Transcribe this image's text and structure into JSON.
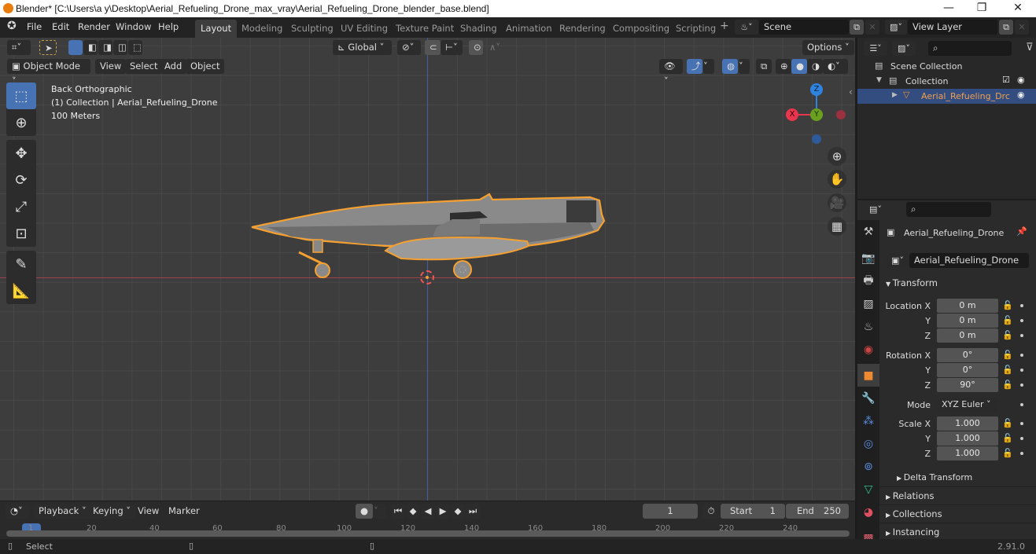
{
  "window": {
    "title": "Blender* [C:\\Users\\a y\\Desktop\\Aerial_Refueling_Drone_max_vray\\Aerial_Refueling_Drone_blender_base.blend]",
    "controls": {
      "minimize": "—",
      "maximize": "❐",
      "close": "✕"
    }
  },
  "menu": [
    "File",
    "Edit",
    "Render",
    "Window",
    "Help"
  ],
  "workspaces": [
    {
      "label": "Layout",
      "active": true
    },
    {
      "label": "Modeling"
    },
    {
      "label": "Sculpting"
    },
    {
      "label": "UV Editing"
    },
    {
      "label": "Texture Paint"
    },
    {
      "label": "Shading"
    },
    {
      "label": "Animation"
    },
    {
      "label": "Rendering"
    },
    {
      "label": "Compositing"
    },
    {
      "label": "Scripting"
    }
  ],
  "add_workspace": "+",
  "scene": {
    "label": "Scene"
  },
  "view_layer": {
    "label": "View Layer"
  },
  "viewport_header": {
    "transform_orientation": "Global",
    "options": "Options",
    "mode": "Object Mode",
    "menus": [
      "View",
      "Select",
      "Add",
      "Object"
    ]
  },
  "viewport_overlay": {
    "view_name": "Back Orthographic",
    "collection_info": "(1) Collection | Aerial_Refueling_Drone",
    "scale": "100 Meters"
  },
  "gizmo": {
    "z": "Z",
    "x": "X",
    "y": "Y",
    "x_color": "#e8364f",
    "y_color": "#6ba01f",
    "z_color": "#2f83e0"
  },
  "outliner": {
    "search_placeholder": "",
    "items": [
      {
        "label": "Scene Collection",
        "level": 0
      },
      {
        "label": "Collection",
        "level": 1,
        "checked": true
      },
      {
        "label": "Aerial_Refueling_Drc",
        "level": 2,
        "selected": true
      }
    ]
  },
  "properties": {
    "search_placeholder": "",
    "object_name": "Aerial_Refueling_Drone",
    "datablock_name": "Aerial_Refueling_Drone",
    "transform_header": "Transform",
    "location": {
      "label": "Location X",
      "x": "0 m",
      "y": "0 m",
      "z": "0 m"
    },
    "rotation": {
      "label": "Rotation X",
      "x": "0°",
      "y": "0°",
      "z": "90°"
    },
    "mode": {
      "label": "Mode",
      "value": "XYZ Euler"
    },
    "scale": {
      "label": "Scale X",
      "x": "1.000",
      "y": "1.000",
      "z": "1.000"
    },
    "axis_labels": {
      "y": "Y",
      "z": "Z"
    },
    "delta_transform": "Delta Transform",
    "panels": [
      "Relations",
      "Collections",
      "Instancing"
    ]
  },
  "timeline": {
    "menus": [
      "Playback",
      "Keying",
      "View",
      "Marker"
    ],
    "current_frame": "1",
    "start_label": "Start",
    "start": "1",
    "end_label": "End",
    "end": "250",
    "ticks": [
      "1",
      "20",
      "40",
      "60",
      "80",
      "100",
      "120",
      "140",
      "160",
      "180",
      "200",
      "220",
      "240"
    ]
  },
  "statusbar": {
    "left_action": "Select",
    "version": "2.91.0"
  },
  "accent": {
    "selection_blue": "#4772b3",
    "outline_orange": "#f5a030"
  }
}
